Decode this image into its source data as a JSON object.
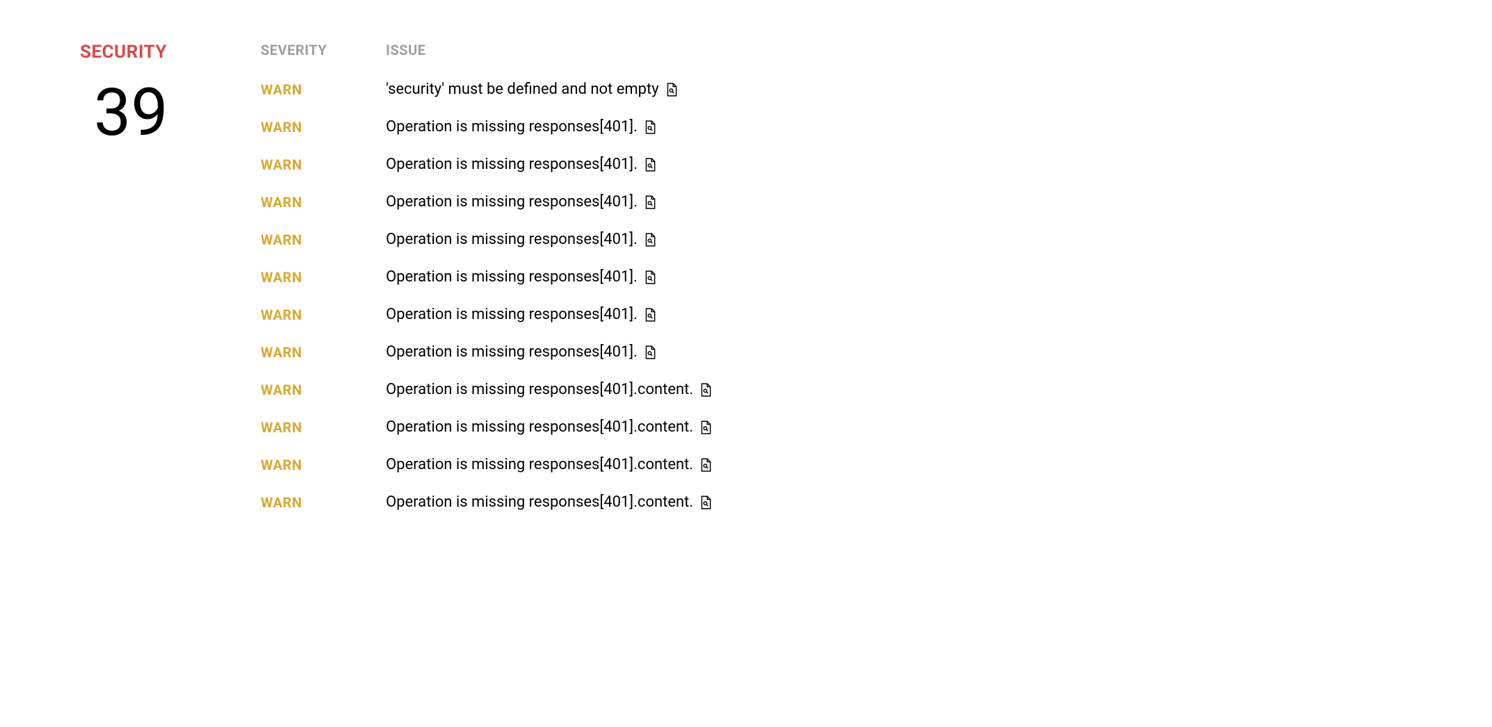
{
  "sidebar": {
    "category": "SECURITY",
    "count": "39"
  },
  "headers": {
    "severity": "SEVERITY",
    "issue": "ISSUE"
  },
  "issues": [
    {
      "severity": "WARN",
      "text": "'security' must be defined and not empty"
    },
    {
      "severity": "WARN",
      "text": "Operation is missing responses[401]."
    },
    {
      "severity": "WARN",
      "text": "Operation is missing responses[401]."
    },
    {
      "severity": "WARN",
      "text": "Operation is missing responses[401]."
    },
    {
      "severity": "WARN",
      "text": "Operation is missing responses[401]."
    },
    {
      "severity": "WARN",
      "text": "Operation is missing responses[401]."
    },
    {
      "severity": "WARN",
      "text": "Operation is missing responses[401]."
    },
    {
      "severity": "WARN",
      "text": "Operation is missing responses[401]."
    },
    {
      "severity": "WARN",
      "text": "Operation is missing responses[401].content."
    },
    {
      "severity": "WARN",
      "text": "Operation is missing responses[401].content."
    },
    {
      "severity": "WARN",
      "text": "Operation is missing responses[401].content."
    },
    {
      "severity": "WARN",
      "text": "Operation is missing responses[401].content."
    }
  ]
}
